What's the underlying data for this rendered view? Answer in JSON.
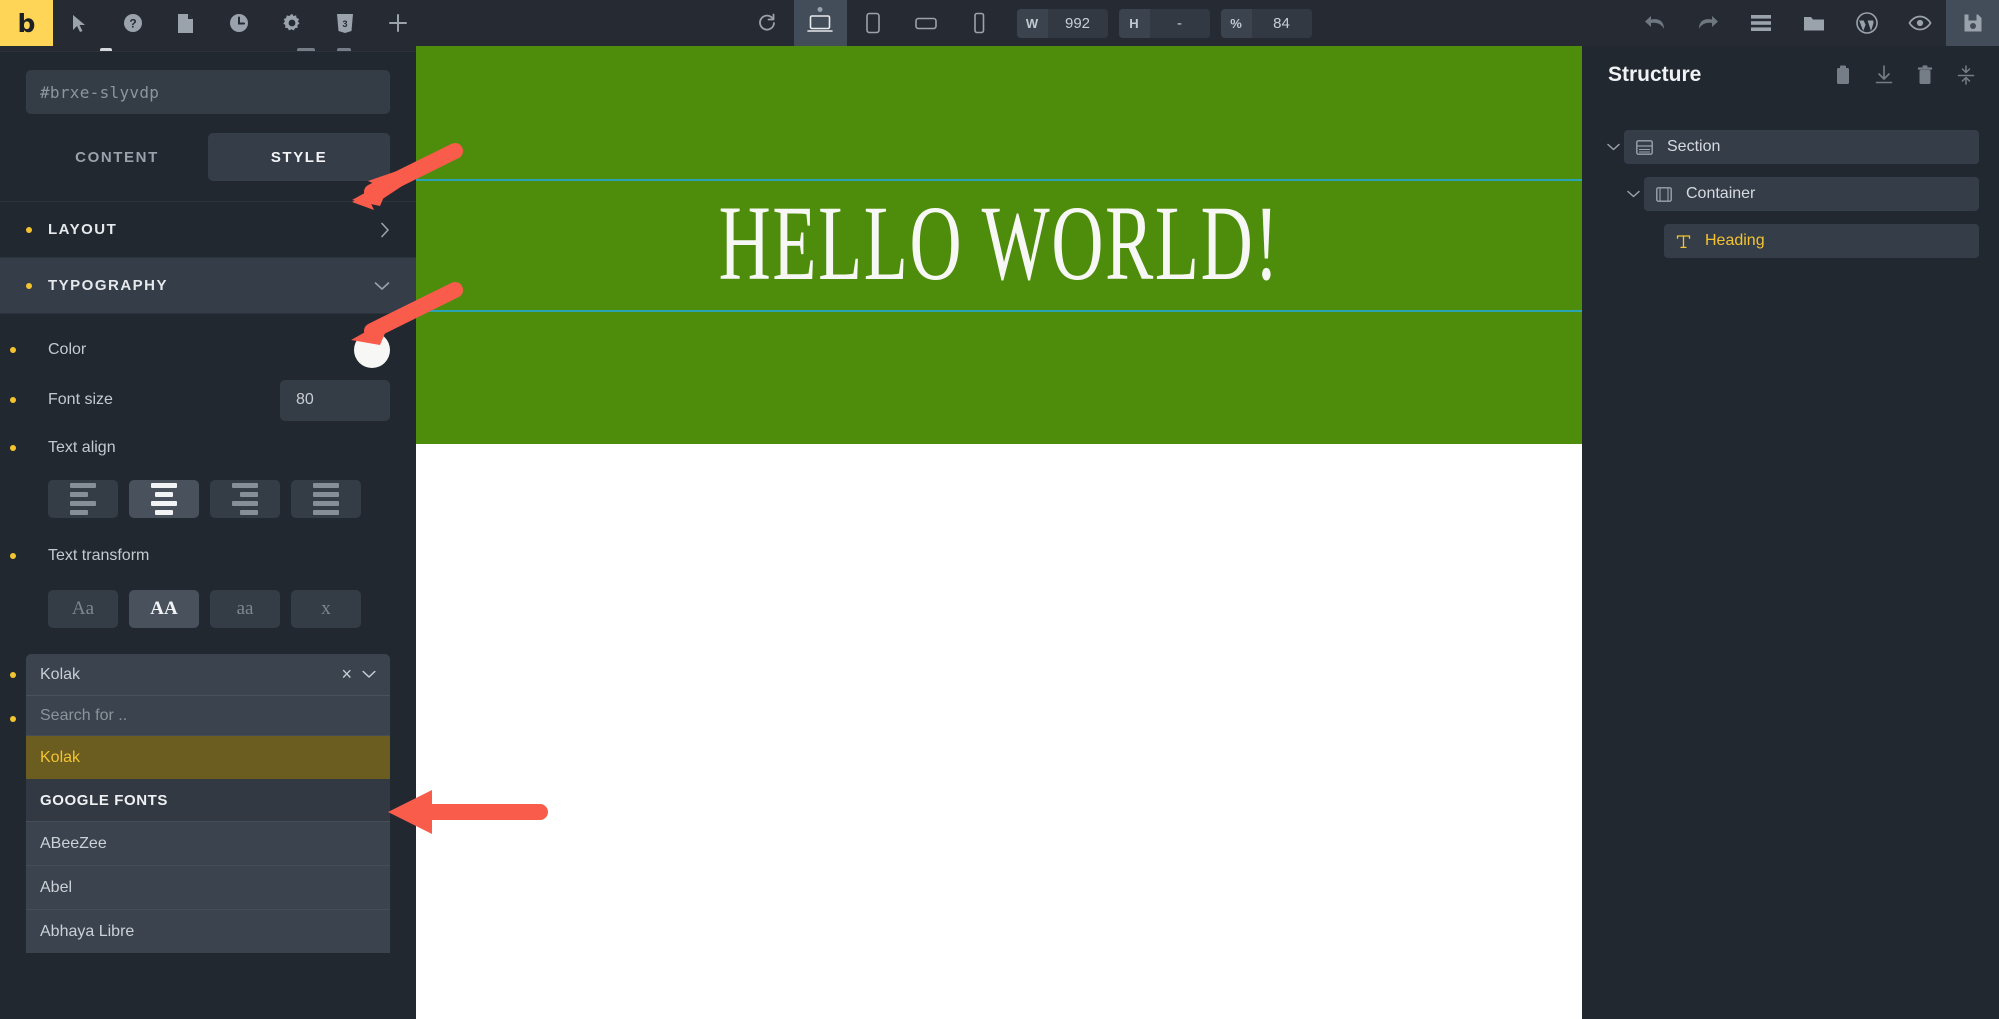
{
  "toolbar": {
    "logo_label": "b",
    "left_icons": [
      {
        "name": "cursor-icon",
        "label": "Select"
      },
      {
        "name": "help-icon",
        "label": "Help"
      },
      {
        "name": "page-icon",
        "label": "Pages"
      },
      {
        "name": "history-icon",
        "label": "Revisions"
      },
      {
        "name": "gear-icon",
        "label": "Settings"
      },
      {
        "name": "css-icon",
        "label": "CSS"
      },
      {
        "name": "plus-icon",
        "label": "Add element"
      }
    ],
    "center": {
      "refresh_label": "Refresh",
      "devices": [
        {
          "name": "desktop-icon",
          "label": "Desktop",
          "active": true
        },
        {
          "name": "tablet-portrait-icon",
          "label": "Tablet portrait",
          "active": false
        },
        {
          "name": "tablet-landscape-icon",
          "label": "Tablet landscape",
          "active": false
        },
        {
          "name": "mobile-icon",
          "label": "Mobile portrait",
          "active": false
        }
      ],
      "width_label": "W",
      "width_value": "992",
      "height_label": "H",
      "height_value": "-",
      "zoom_label": "%",
      "zoom_value": "84"
    },
    "right_icons": [
      {
        "name": "undo-icon",
        "label": "Undo"
      },
      {
        "name": "redo-icon",
        "label": "Redo"
      },
      {
        "name": "structure-icon",
        "label": "Structure"
      },
      {
        "name": "folder-icon",
        "label": "Templates"
      },
      {
        "name": "wordpress-icon",
        "label": "WordPress"
      },
      {
        "name": "eye-icon",
        "label": "Preview"
      },
      {
        "name": "save-icon",
        "label": "Save"
      }
    ]
  },
  "left_panel": {
    "element_id": "#brxe-slyvdp",
    "tabs": [
      {
        "label": "CONTENT",
        "active": false
      },
      {
        "label": "STYLE",
        "active": true
      }
    ],
    "sections": [
      {
        "label": "LAYOUT",
        "open": false
      },
      {
        "label": "TYPOGRAPHY",
        "open": true
      }
    ],
    "typography": {
      "color_label": "Color",
      "color_value": "#f7f7f5",
      "font_size_label": "Font size",
      "font_size_value": "80",
      "text_align_label": "Text align",
      "text_align_options": [
        {
          "name": "align-left",
          "active": false
        },
        {
          "name": "align-center",
          "active": true
        },
        {
          "name": "align-right",
          "active": false
        },
        {
          "name": "align-justify",
          "active": false
        }
      ],
      "text_transform_label": "Text transform",
      "text_transform_options": [
        {
          "label": "Aa",
          "name": "capitalize",
          "active": false
        },
        {
          "label": "AA",
          "name": "uppercase",
          "active": true
        },
        {
          "label": "aa",
          "name": "lowercase",
          "active": false
        },
        {
          "label": "x",
          "name": "none",
          "active": false
        }
      ],
      "font_family": {
        "selected": "Kolak",
        "clear_label": "×",
        "search_placeholder": "Search for ..",
        "highlighted_option": "Kolak",
        "group_label": "GOOGLE FONTS",
        "options": [
          "ABeeZee",
          "Abel",
          "Abhaya Libre"
        ]
      }
    }
  },
  "canvas": {
    "heading_text": "HELLO WORLD!",
    "section_bg": "#4e8c0c",
    "selection_border": "#2aa3b5",
    "heading_color": "#f7f8f5"
  },
  "right_panel": {
    "title": "Structure",
    "actions": [
      {
        "name": "clipboard-icon",
        "label": "Copy"
      },
      {
        "name": "download-icon",
        "label": "Import"
      },
      {
        "name": "trash-icon",
        "label": "Delete"
      },
      {
        "name": "collapse-icon",
        "label": "Collapse all"
      }
    ],
    "tree": [
      {
        "label": "Section",
        "icon": "section-icon",
        "level": 1,
        "active": false,
        "expanded": true
      },
      {
        "label": "Container",
        "icon": "container-icon",
        "level": 2,
        "active": false,
        "expanded": true
      },
      {
        "label": "Heading",
        "icon": "text-icon",
        "level": 3,
        "active": true,
        "expanded": false
      }
    ]
  },
  "annotations": {
    "arrow_color": "#fa5c4c",
    "arrows": [
      {
        "name": "arrow-to-style-tab",
        "target": "STYLE tab"
      },
      {
        "name": "arrow-to-typography-section",
        "target": "TYPOGRAPHY section"
      },
      {
        "name": "arrow-to-kolak-option",
        "target": "Kolak font option"
      }
    ]
  }
}
